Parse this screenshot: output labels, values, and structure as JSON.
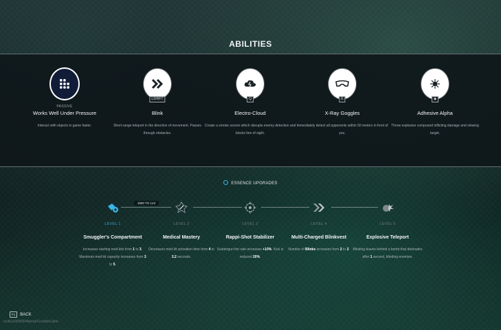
{
  "screen": {
    "title": "ABILITIES",
    "back_key": "F1",
    "back_label": "BACK",
    "build_string": "ec3b1e3090544/prod/CrucibleClient"
  },
  "abilities": [
    {
      "name": "Works Well Under Pressure",
      "tag": "PASSIVE",
      "key": "",
      "icon": "keypad-icon",
      "description": "Interact with objects in game faster."
    },
    {
      "name": "Blink",
      "tag": "",
      "key": "LSHIFT",
      "icon": "double-chevron-icon",
      "description": "Short-range teleport in the direction of movement. Passes through obstacles."
    },
    {
      "name": "Electro-Cloud",
      "tag": "",
      "key": "Q",
      "icon": "cloud-icon",
      "description": "Create a smoke screen which disrupts enemy detection and blocks line of sight."
    },
    {
      "name": "X-Ray Goggles",
      "tag": "",
      "key": "E",
      "icon": "goggles-icon",
      "description": "Immediately detect all opponents within 50 meters in front of you."
    },
    {
      "name": "Adhesive Alpha",
      "tag": "",
      "key": "",
      "icon": "bug-bomb-icon",
      "description": "Throw explosive compound inflicting damage and slowing target."
    }
  ],
  "essence": {
    "header": "ESSENCE UPGRADES",
    "cost_badge": "1800 TO LV2",
    "accent_color": "#39b6e8",
    "upgrades": [
      {
        "level": "LEVEL 1",
        "name": "Smuggler's Compartment",
        "icon": "medkit-plus-icon",
        "active": true,
        "desc": [
          "Increases starting med kits from ",
          "1",
          " to ",
          "3",
          ". Maximum med kit capacity increases from ",
          "3",
          " to ",
          "5",
          "."
        ]
      },
      {
        "level": "LEVEL 2",
        "name": "Medical Mastery",
        "icon": "syringe-badge-icon",
        "active": false,
        "desc": [
          "Decreases med kit activation time from ",
          "4",
          " to ",
          "3.2",
          " seconds."
        ]
      },
      {
        "level": "LEVEL 3",
        "name": "Rappi-Shot Stabilizer",
        "icon": "crosshair-gear-icon",
        "active": false,
        "desc": [
          "Scattergun fire rate increases ",
          "+10%",
          ". Kick is reduced ",
          "20%",
          "."
        ]
      },
      {
        "level": "LEVEL 4",
        "name": "Multi-Charged Blinkvest",
        "icon": "double-chevron-icon",
        "active": false,
        "desc": [
          "Number of ",
          "Blinks",
          " increases from ",
          "2",
          " to ",
          "3",
          "."
        ]
      },
      {
        "level": "LEVEL 5",
        "name": "Explosive Teleport",
        "icon": "bomb-burst-icon",
        "active": false,
        "desc": [
          "Blinking leaves behind a bomb that detonates after ",
          "1",
          " second, blinding enemies."
        ]
      }
    ]
  }
}
